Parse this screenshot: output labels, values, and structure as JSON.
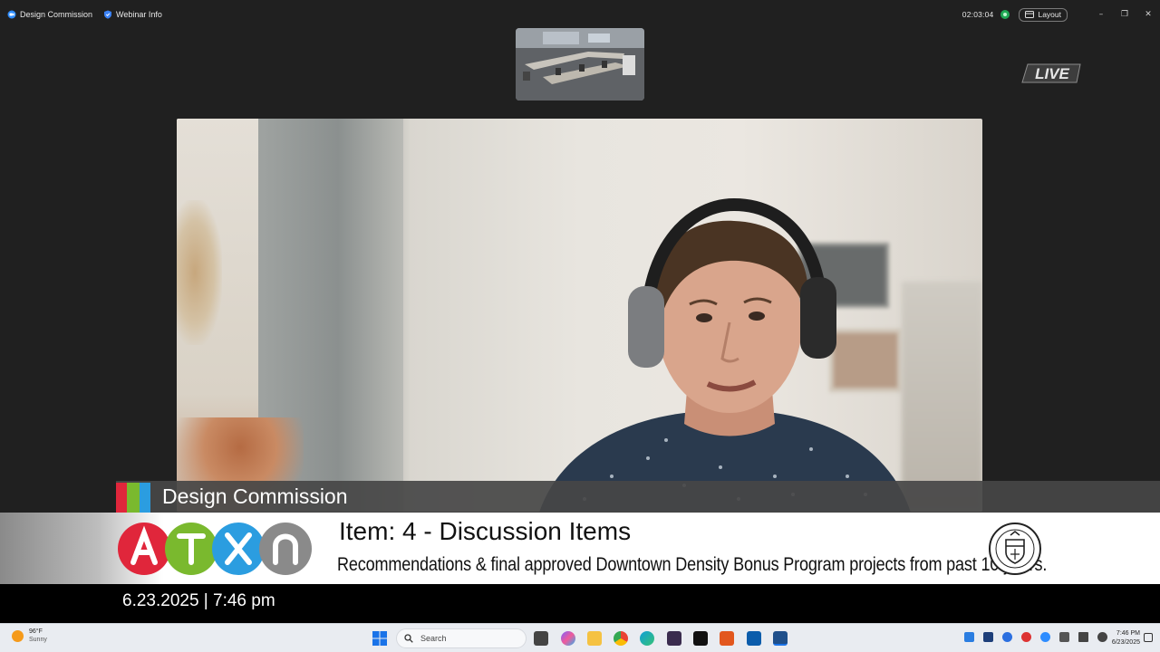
{
  "window": {
    "tabs": [
      {
        "label": "Design Commission",
        "icon": "zoom-app-icon"
      },
      {
        "label": "Webinar Info",
        "icon": "shield-icon"
      }
    ],
    "timer": "02:03:04",
    "layout_label": "Layout",
    "controls": {
      "minimize": "–",
      "restore": "❐",
      "close": "✕"
    }
  },
  "live_badge": "LIVE",
  "lower_third": {
    "commission": "Design Commission",
    "item_title": "Item: 4 - Discussion Items",
    "item_subtitle": "Recommendations & final approved Downtown Density Bonus Program projects from past 10 years.",
    "date_time": "6.23.2025 | 7:46 pm",
    "atxn_letters": [
      "A",
      "T",
      "X",
      "N"
    ],
    "atxn_colors": [
      "#e0263b",
      "#7ab92e",
      "#2b9de0",
      "#8a8a8a"
    ]
  },
  "taskbar": {
    "weather_temp": "96°F",
    "weather_desc": "Sunny",
    "search_placeholder": "Search",
    "clock_time": "7:46 PM",
    "clock_date": "6/23/2025"
  }
}
